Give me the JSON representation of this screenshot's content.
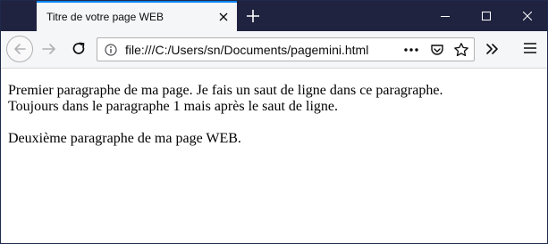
{
  "browser": {
    "tab": {
      "title": "Titre de votre page WEB"
    },
    "url": "file:///C:/Users/sn/Documents/pagemini.html"
  },
  "icons": {
    "tab_close": "close-icon",
    "new_tab": "plus-icon",
    "minimize": "minimize-icon",
    "maximize": "maximize-icon",
    "close_window": "close-icon",
    "back": "arrow-left-icon",
    "forward": "arrow-right-icon",
    "reload": "reload-icon",
    "site_info": "info-icon",
    "page_actions": "more-dots-icon",
    "pocket": "pocket-icon",
    "bookmark": "star-icon",
    "overflow": "chevron-double-right-icon",
    "menu": "hamburger-icon"
  },
  "colors": {
    "titlebar": "#202340",
    "tab_accent": "#0a84ff",
    "toolbar": "#f5f6f7"
  },
  "content": {
    "paragraph1": "Premier paragraphe de ma page. Je fais un saut de ligne dans ce paragraphe.\nToujours dans le paragraphe 1 mais après le saut de ligne.",
    "paragraph2": "Deuxième paragraphe de ma page WEB."
  }
}
